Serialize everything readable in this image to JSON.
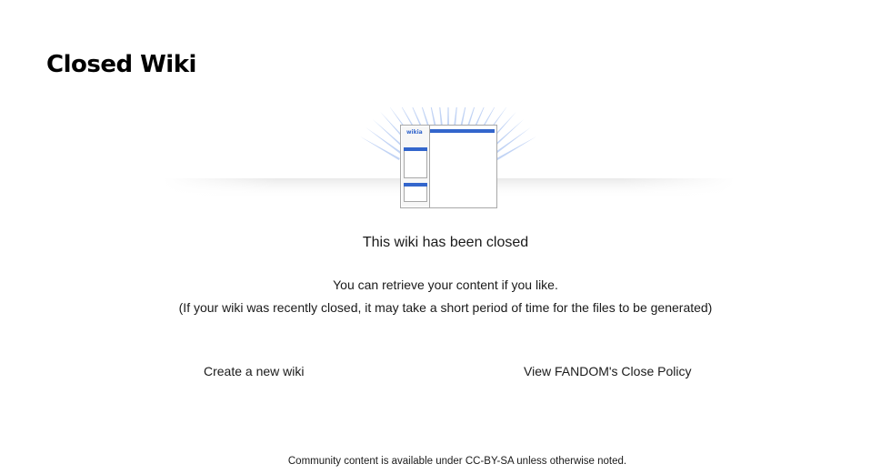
{
  "page": {
    "title": "Closed Wiki"
  },
  "illustration": {
    "logo_text": "wikia",
    "accent_color": "#3366cc",
    "ray_color": "#b7cdf3"
  },
  "status": {
    "heading": "This wiki has been closed",
    "retrieve_text": "You can retrieve your content if you like.",
    "delay_note": "(If your wiki was recently closed, it may take a short period of time for the files to be generated)"
  },
  "links": {
    "create_wiki": "Create a new wiki",
    "close_policy": "View FANDOM's Close Policy"
  },
  "footer": {
    "license_note": "Community content is available under CC-BY-SA unless otherwise noted."
  }
}
